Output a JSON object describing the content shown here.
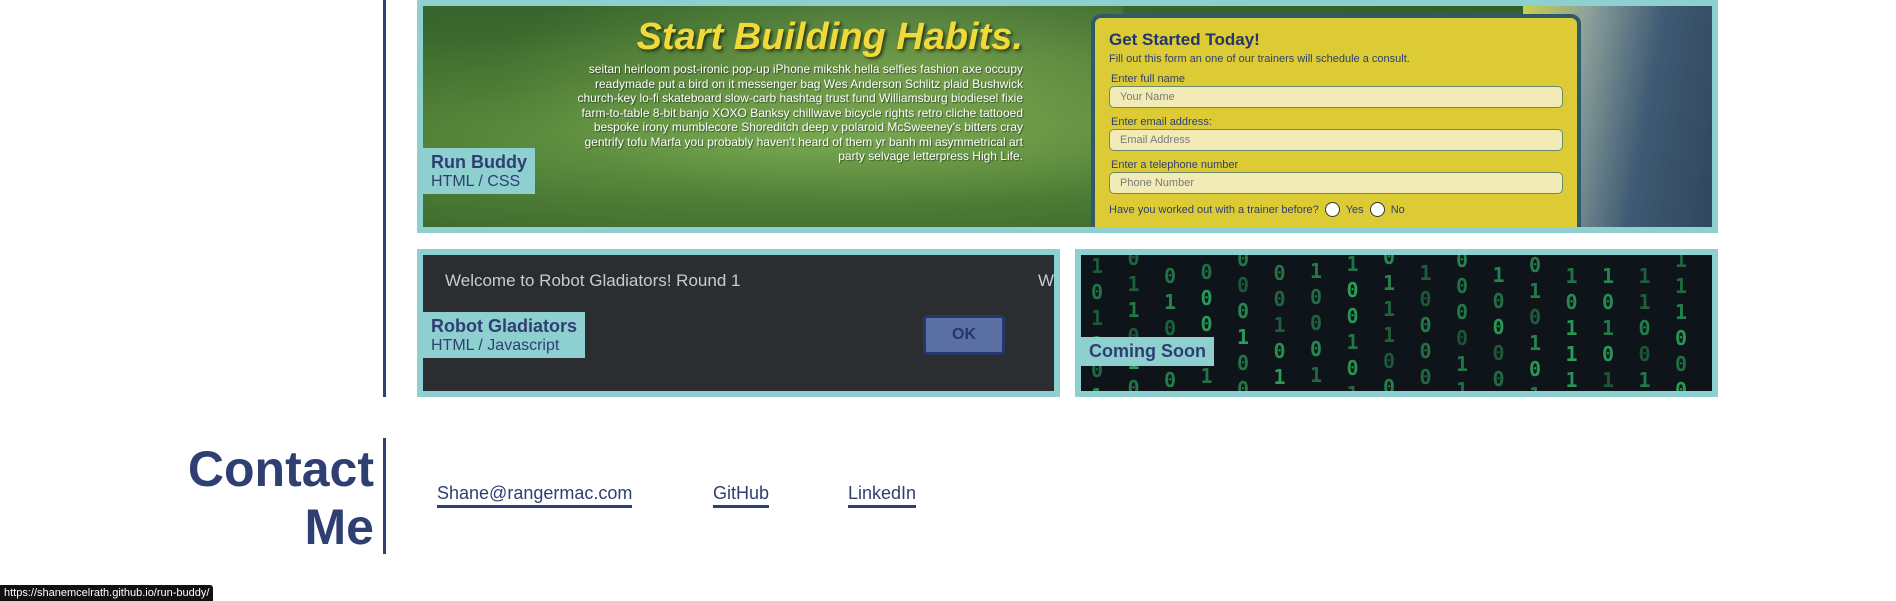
{
  "projects": [
    {
      "title": "Run Buddy",
      "tech": "HTML / CSS",
      "hero_title": "Start Building Habits.",
      "hero_body": "seitan heirloom post-ironic pop-up iPhone mikshk hella selfies fashion axe occupy readymade put a bird on it messenger bag Wes Anderson Schlitz plaid Bushwick church-key lo-fi skateboard slow-carb hashtag trust fund Williamsburg biodiesel fixie farm-to-table 8-bit banjo XOXO Banksy chillwave bicycle rights retro cliche tattooed bespoke irony mumblecore Shoreditch deep v polaroid McSweeney's bitters cray gentrify tofu Marfa you probably haven't heard of them yr banh mi asymmetrical art party selvage letterpress High Life.",
      "form": {
        "title": "Get Started Today!",
        "subtitle": "Fill out this form an one of our trainers will schedule a consult.",
        "name_label": "Enter full name",
        "name_placeholder": "Your Name",
        "email_label": "Enter email address:",
        "email_placeholder": "Email Address",
        "phone_label": "Enter a telephone number",
        "phone_placeholder": "Phone Number",
        "question": "Have you worked out with a trainer before?",
        "yes": "Yes",
        "no": "No"
      }
    },
    {
      "title": "Robot Gladiators",
      "tech": "HTML / Javascript",
      "dialog_text": "Welcome to Robot Gladiators! Round 1",
      "dialog_edge_text": "W",
      "ok_label": "OK"
    },
    {
      "title": "Coming Soon"
    }
  ],
  "contact": {
    "title_line1": "Contact",
    "title_line2": "Me",
    "links": [
      "Shane@rangermac.com",
      "GitHub",
      "LinkedIn"
    ]
  },
  "status_url": "https://shanemcelrath.github.io/run-buddy/"
}
